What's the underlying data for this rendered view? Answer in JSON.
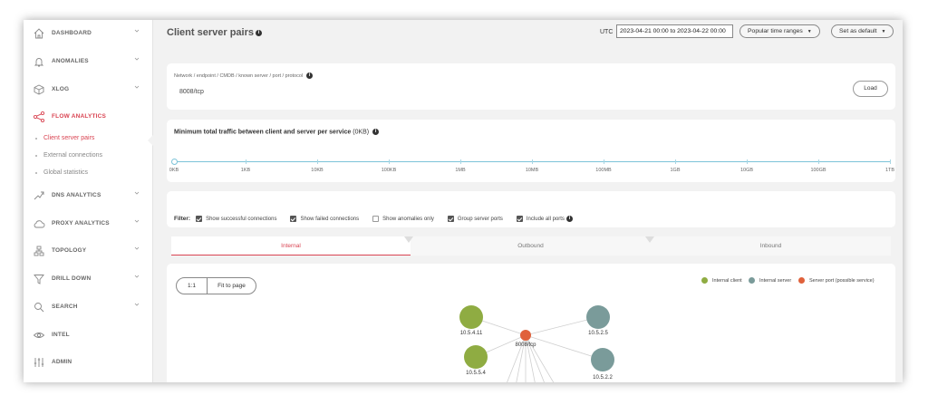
{
  "sidebar": {
    "items": [
      {
        "label": "DASHBOARD",
        "icon": "home-icon"
      },
      {
        "label": "ANOMALIES",
        "icon": "bell-icon"
      },
      {
        "label": "XLOG",
        "icon": "cube-icon"
      },
      {
        "label": "FLOW ANALYTICS",
        "icon": "share-nodes-icon"
      },
      {
        "label": "DNS ANALYTICS",
        "icon": "dns-icon"
      },
      {
        "label": "PROXY ANALYTICS",
        "icon": "cloud-icon"
      },
      {
        "label": "TOPOLOGY",
        "icon": "topology-icon"
      },
      {
        "label": "DRILL DOWN",
        "icon": "funnel-icon"
      },
      {
        "label": "SEARCH",
        "icon": "search-icon"
      },
      {
        "label": "INTEL",
        "icon": "eye-icon"
      },
      {
        "label": "ADMIN",
        "icon": "sliders-icon"
      }
    ],
    "sub_items": [
      {
        "label": "Client server pairs"
      },
      {
        "label": "External connections"
      },
      {
        "label": "Global statistics"
      }
    ]
  },
  "header": {
    "title": "Client server pairs",
    "utc_label": "UTC",
    "date_range": "2023-04-21 00:00 to 2023-04-22 00:00",
    "popular_label": "Popular time ranges",
    "default_label": "Set as default"
  },
  "query": {
    "label": "Network / endpoint / CMDB / known server / port / protocol",
    "value": "8008/tcp",
    "load_label": "Load"
  },
  "traffic": {
    "title": "Minimum total traffic between client and server per service",
    "unit": "(0KB)",
    "ticks": [
      "0KB",
      "1KB",
      "10KB",
      "100KB",
      "1MB",
      "10MB",
      "100MB",
      "1GB",
      "10GB",
      "100GB",
      "1TB"
    ]
  },
  "filter": {
    "label": "Filter:",
    "options": [
      {
        "label": "Show successful connections",
        "checked": true
      },
      {
        "label": "Show failed connections",
        "checked": true
      },
      {
        "label": "Show anomalies only",
        "checked": false
      },
      {
        "label": "Group server ports",
        "checked": true
      },
      {
        "label": "Include all ports",
        "checked": true
      }
    ]
  },
  "tabs": [
    {
      "label": "Internal",
      "active": true
    },
    {
      "label": "Outbound",
      "active": false
    },
    {
      "label": "Inbound",
      "active": false
    }
  ],
  "graph_controls": {
    "zoom_label": "1:1",
    "fit_label": "Fit to page"
  },
  "legend": [
    {
      "label": "Internal client",
      "color": "#8fac42"
    },
    {
      "label": "Internal server",
      "color": "#7a9b9a"
    },
    {
      "label": "Server port (possible service)",
      "color": "#e0613b"
    }
  ],
  "graph": {
    "nodes": [
      {
        "label": "10.5.4.11",
        "kind": "client"
      },
      {
        "label": "10.5.5.4",
        "kind": "client"
      },
      {
        "label": "8008/tcp",
        "kind": "port"
      },
      {
        "label": "10.5.2.5",
        "kind": "server"
      },
      {
        "label": "10.5.2.2",
        "kind": "server"
      }
    ]
  },
  "colors": {
    "accent": "#d94452",
    "slider": "#7cc3d8"
  }
}
